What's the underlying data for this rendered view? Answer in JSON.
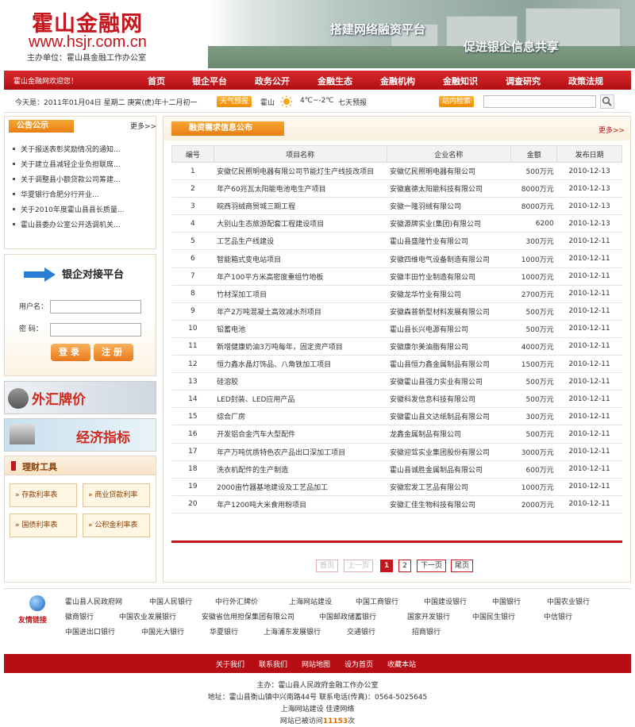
{
  "header": {
    "logo_title": "霍山金融网",
    "logo_url": "www.hsjr.com.cn",
    "logo_org": "主办单位：霍山县金融工作办公室",
    "slogan_1": "搭建网络融资平台",
    "slogan_2": "促进银企信息共享"
  },
  "nav": {
    "welcome": "霍山金融网欢迎您！",
    "items": [
      "首页",
      "银企平台",
      "政务公开",
      "金融生态",
      "金融机构",
      "金融知识",
      "调查研究",
      "政策法规"
    ]
  },
  "infobar": {
    "date": "今天是：2011年01月04日  星期二  庚寅(虎)年十二月初一",
    "weather_tag": "天气预报",
    "weather_city": "霍山",
    "weather_icon": "sun-icon",
    "weather_temp": "4℃~-2℃",
    "weather_forecast": "七天预报",
    "search_tag": "站内检索",
    "search_value": ""
  },
  "notice": {
    "title": "公告公示",
    "more": "更多>>",
    "items": [
      "关于报送表彰奖励情况的通知...",
      "关于建立县减轻企业负担联席...",
      "关于调整县小额贷款公司筹建...",
      "华夏银行合肥分行开业...",
      "关于2010年度霍山县县长质量...",
      "霍山县委办公室公开选调机关..."
    ]
  },
  "login": {
    "title": "银企对接平台",
    "user_label": "用户名：",
    "pwd_label": "密  码：",
    "login_btn": "登录",
    "register_btn": "注册"
  },
  "banners": {
    "fx": "外汇牌价",
    "econ": "经济指标"
  },
  "tools": {
    "title": "理财工具",
    "items": [
      "存款利率表",
      "商业贷款利率",
      "国债利率表",
      "公积金利率表"
    ]
  },
  "main": {
    "title": "融资需求信息公布",
    "more": "更多>>",
    "columns": [
      "编号",
      "项目名称",
      "企业名称",
      "金额",
      "发布日期"
    ],
    "rows": [
      [
        "1",
        "安徽亿民照明电器有限公司节能灯生产线技改项目",
        "安徽亿民照明电器有限公司",
        "500万元",
        "2010-12-13"
      ],
      [
        "2",
        "年产60兆瓦太阳能电池电生产项目",
        "安徽嘉德太阳能科技有限公司",
        "8000万元",
        "2010-12-13"
      ],
      [
        "3",
        "皖西羽绒商贸城三期工程",
        "安徽一隆羽绒有限公司",
        "8000万元",
        "2010-12-13"
      ],
      [
        "4",
        "大别山生态旅游配套工程建设项目",
        "安徽源牌实业(集团)有限公司",
        "6200",
        "2010-12-13"
      ],
      [
        "5",
        "工艺品生产线建设",
        "霍山县盛隆竹业有限公司",
        "300万元",
        "2010-12-11"
      ],
      [
        "6",
        "智能箱式变电站项目",
        "安徽四维电气设备制造有限公司",
        "1000万元",
        "2010-12-11"
      ],
      [
        "7",
        "年产100平方米高密度重组竹地板",
        "安徽丰田竹业制造有限公司",
        "1000万元",
        "2010-12-11"
      ],
      [
        "8",
        "竹材深加工项目",
        "安徽龙华竹业有限公司",
        "2700万元",
        "2010-12-11"
      ],
      [
        "9",
        "年产2万吨混凝土高效减水剂项目",
        "安徽森普新型材料发展有限公司",
        "500万元",
        "2010-12-11"
      ],
      [
        "10",
        "铅蓄电池",
        "霍山县长兴电源有限公司",
        "500万元",
        "2010-12-11"
      ],
      [
        "11",
        "新增健康奶油3万吨每年，固定资产项目",
        "安徽康尔美油脂有限公司",
        "4000万元",
        "2010-12-11"
      ],
      [
        "12",
        "恒力鑫水晶灯饰品、八角铁加工项目",
        "霍山县恒力鑫金属制品有限公司",
        "1500万元",
        "2010-12-11"
      ],
      [
        "13",
        "硅溶胶",
        "安徽霍山县强力实业有限公司",
        "500万元",
        "2010-12-11"
      ],
      [
        "14",
        "LED封装、LED应用产品",
        "安徽科发信息科技有限公司",
        "500万元",
        "2010-12-11"
      ],
      [
        "15",
        "综合厂房",
        "安徽霍山县文达纸制品有限公司",
        "300万元",
        "2010-12-11"
      ],
      [
        "16",
        "开发铝合金汽车大型配件",
        "龙鑫金属制品有限公司",
        "500万元",
        "2010-12-11"
      ],
      [
        "17",
        "年产万吨优质特色农产品出口深加工项目",
        "安徽迎驾实业集团股份有限公司",
        "3000万元",
        "2010-12-11"
      ],
      [
        "18",
        "洗衣机配件的生产制造",
        "霍山县诚胜金属制品有限公司",
        "600万元",
        "2010-12-11"
      ],
      [
        "19",
        "2000亩竹器基地建设及工艺品加工",
        "安徽宏发工艺品有限公司",
        "1000万元",
        "2010-12-11"
      ],
      [
        "20",
        "年产1200吨大米食用粉项目",
        "安徽汇佳生物科技有限公司",
        "2000万元",
        "2010-12-11"
      ]
    ],
    "pagination": {
      "first": "首页",
      "prev": "上一页",
      "pages": [
        "1",
        "2"
      ],
      "next": "下一页",
      "last": "尾页"
    }
  },
  "links": {
    "label": "友情链接",
    "row1": [
      "霍山县人民政府网",
      "中国人民银行",
      "中行外汇牌价",
      "上海网站建设",
      "中国工商银行",
      "中国建设银行",
      "中国银行",
      "中国农业银行"
    ],
    "row2": [
      "徽商银行",
      "中国农业发展银行",
      "安徽省信用担保集团有限公司",
      "中国邮政储蓄银行",
      "国家开发银行",
      "中国民生银行",
      "中信银行"
    ],
    "row3": [
      "中国进出口银行",
      "中国光大银行",
      "华夏银行",
      "上海浦东发展银行",
      "交通银行",
      "招商银行"
    ]
  },
  "footer": {
    "nav": [
      "关于我们",
      "联系我们",
      "网站地图",
      "设为首页",
      "收藏本站"
    ],
    "sponsor": "主办：霍山县人民政府金融工作办公室",
    "address": "地址：霍山县衡山镇中兴南路44号  联系电话(传真)：0564-5025645",
    "builder": "上海网站建设  佳速网络",
    "visits_prefix": "网站已被访问",
    "visits_count": "11153",
    "visits_suffix": "次"
  },
  "colors": {
    "brand_red": "#c4161c",
    "accent_orange": "#ea7e11"
  }
}
